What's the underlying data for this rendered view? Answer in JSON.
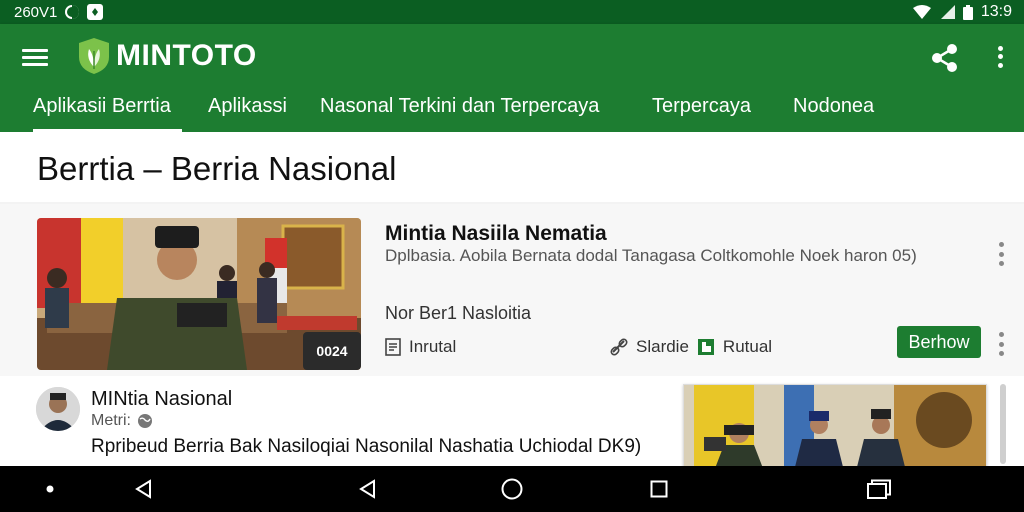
{
  "status_bar": {
    "left_text": "260V1",
    "time": "13:9",
    "icons": [
      "moon-icon",
      "notification-icon",
      "wifi-icon",
      "signal-icon",
      "battery-icon"
    ]
  },
  "app_bar": {
    "logo_text": "MINTOTO",
    "icons": [
      "menu-icon",
      "leaf-shield-logo",
      "share-icon",
      "more-vert-icon"
    ],
    "color": "#1d7d31"
  },
  "tabs": [
    {
      "label": "Aplikasii Berrtia",
      "active": true
    },
    {
      "label": "Aplikassi",
      "active": false
    },
    {
      "label": "Nasonal Terkini dan Terpercaya",
      "active": false
    },
    {
      "label": "Terpercaya",
      "active": false
    },
    {
      "label": "Nodonea",
      "active": false
    }
  ],
  "section": {
    "title": "Berrtia – Berria Nasional"
  },
  "article1": {
    "image_caption": "0024",
    "title": "Mintia Nasiila Nematia",
    "description": "Dplbasia. Aobila Bernata dodal Tanagasa Coltkomohle Noek haron 05)",
    "subtitle": "Nor Ber1 Nasloitia",
    "meta_left": "Inrutal",
    "meta_source": "Slardie",
    "meta_tag": "Rutual",
    "action_label": "Berhow"
  },
  "article2": {
    "title": "MINtia Nasional",
    "meta": "Metri:",
    "description": "Rpribeud Berria Bak Nasiloqiai Nasonilal Nashatia Uchiodal DK9)"
  },
  "nav_bar": {
    "icons": [
      "dot-icon",
      "back-icon",
      "back-icon",
      "home-icon",
      "recents-icon",
      "rotate-icon"
    ]
  }
}
